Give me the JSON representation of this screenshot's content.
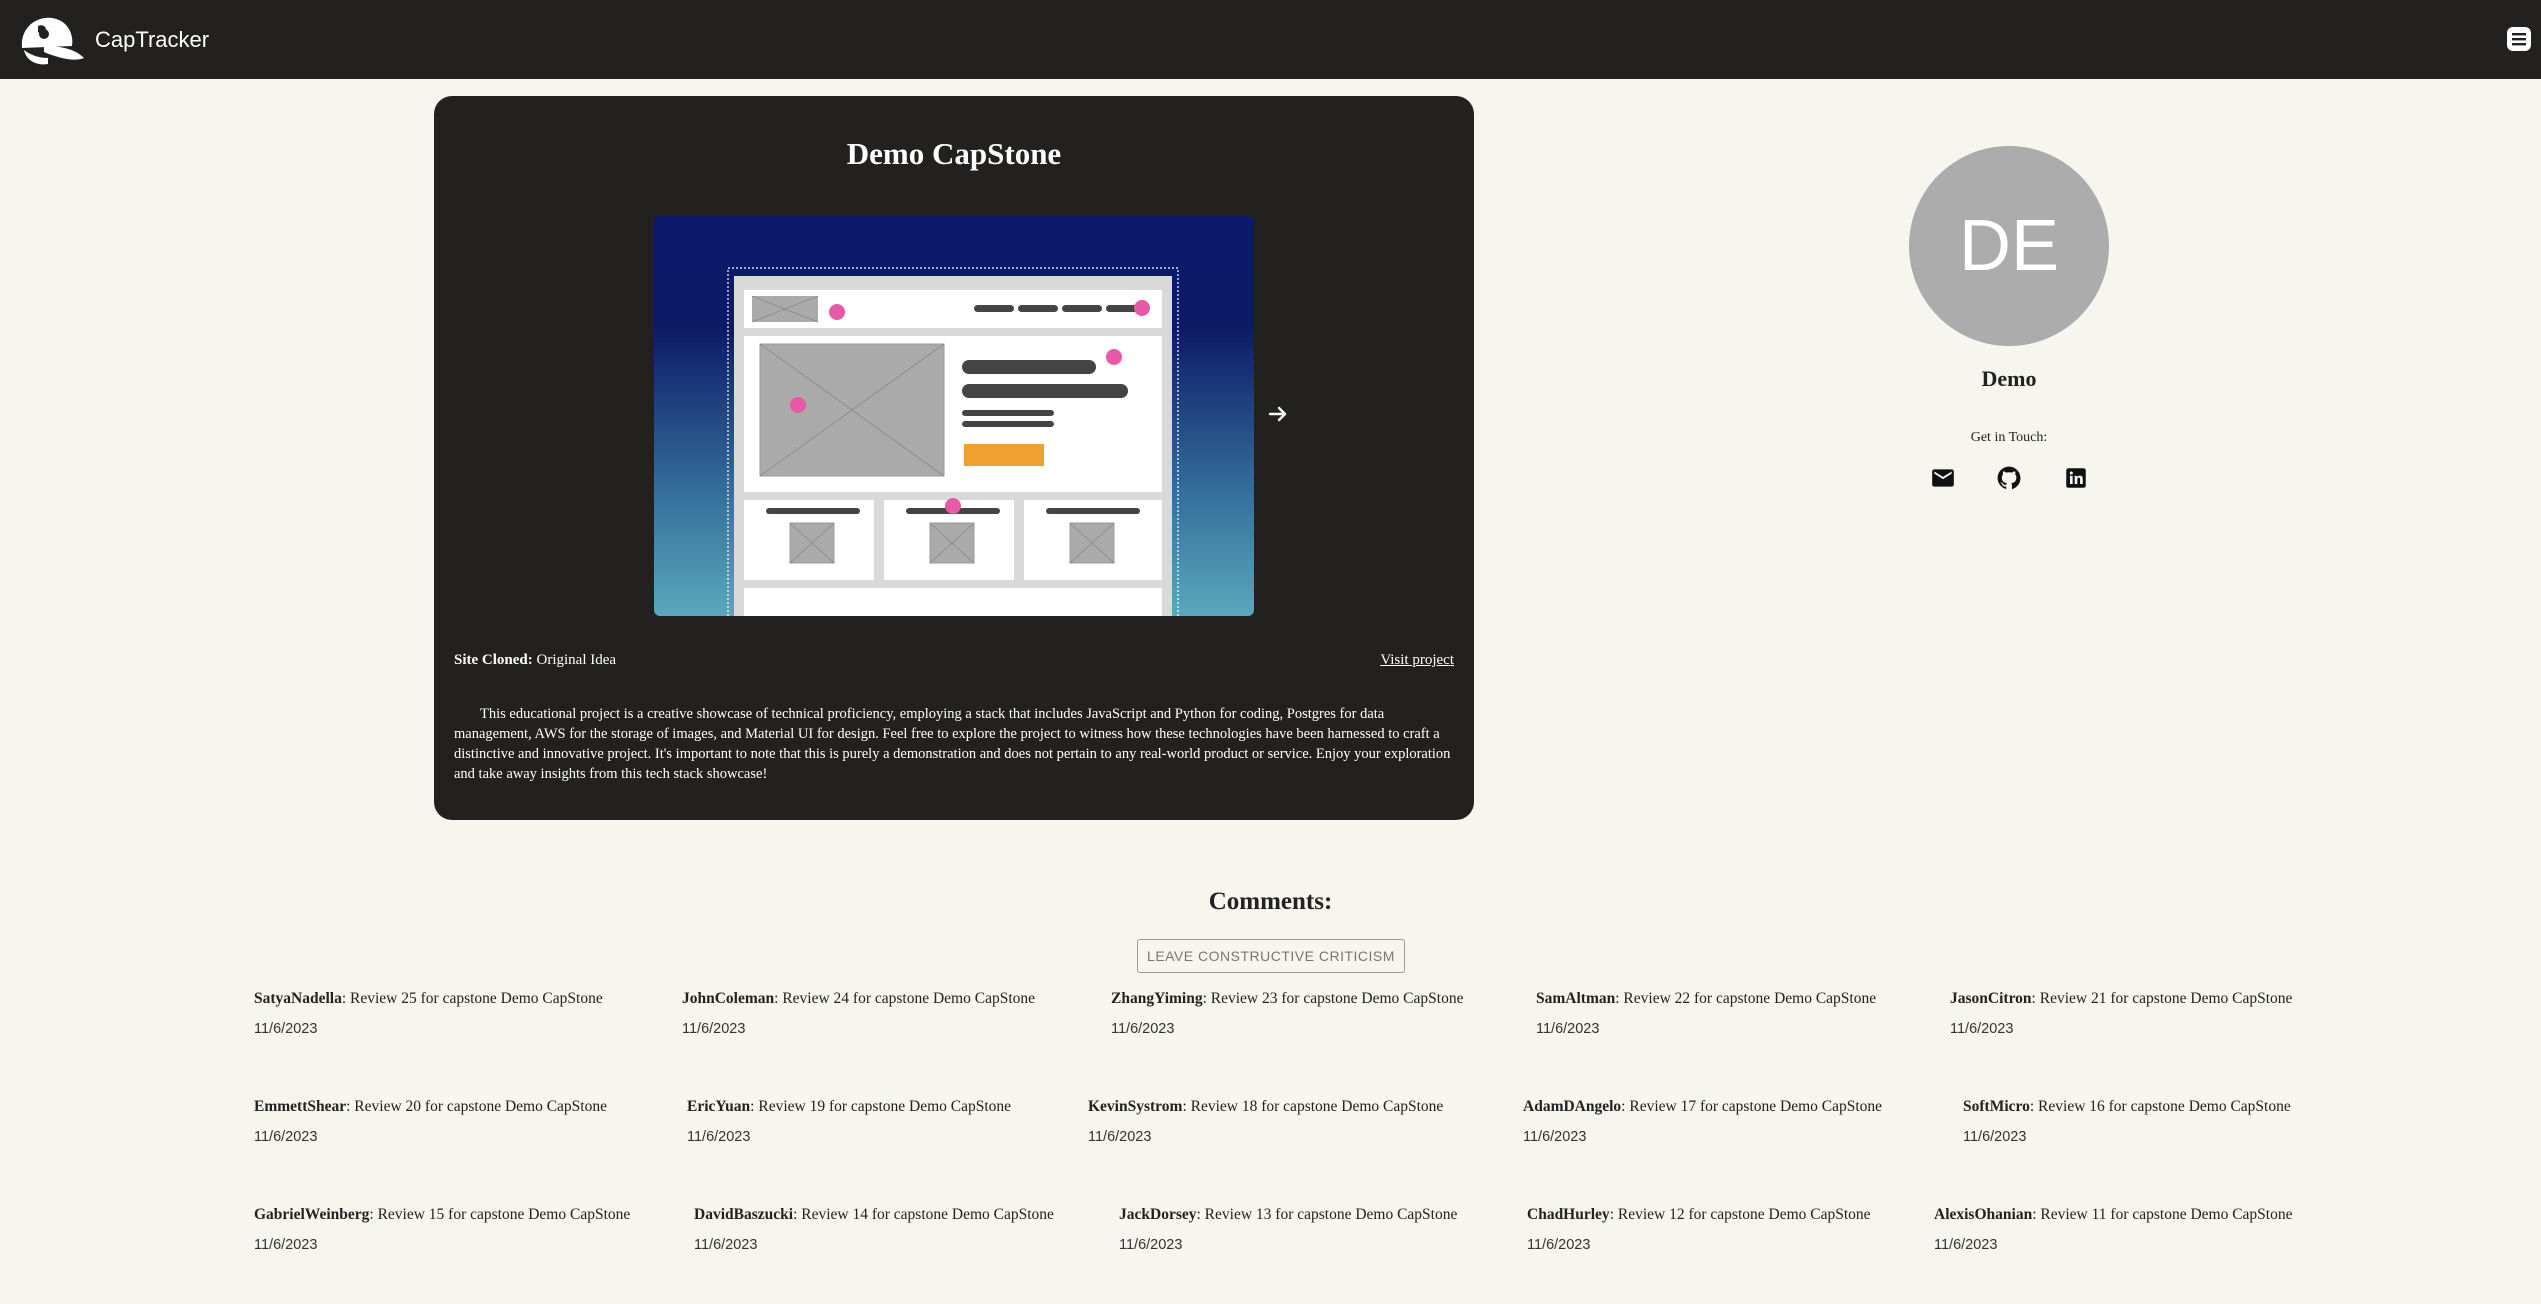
{
  "header": {
    "brand": "CapTracker",
    "logo_icon": "cap-logo-icon",
    "menu_icon": "menu-icon"
  },
  "project": {
    "title": "Demo CapStone",
    "site_cloned_label": "Site Cloned:",
    "site_cloned_value": "Original Idea",
    "visit_label": "Visit project",
    "description": "This educational project is a creative showcase of technical proficiency, employing a stack that includes JavaScript and Python for coding, Postgres for data management, AWS for the storage of images, and Material UI for design. Feel free to explore the project to witness how these technologies have been harnessed to craft a distinctive and innovative project. It's important to note that this is purely a demonstration and does not pertain to any real-world product or service. Enjoy your exploration and take away insights from this tech stack showcase!"
  },
  "profile": {
    "initials": "DE",
    "name": "Demo",
    "get_in_touch": "Get in Touch:",
    "contact_icons": [
      "email-icon",
      "github-icon",
      "linkedin-icon"
    ]
  },
  "comments": {
    "heading": "Comments:",
    "leave_button": "LEAVE CONSTRUCTIVE CRITICISM",
    "items": [
      {
        "author": "SatyaNadella",
        "text": ": Review 25 for capstone Demo CapStone",
        "date": "11/6/2023"
      },
      {
        "author": "JohnColeman",
        "text": ": Review 24 for capstone Demo CapStone",
        "date": "11/6/2023"
      },
      {
        "author": "ZhangYiming",
        "text": ": Review 23 for capstone Demo CapStone",
        "date": "11/6/2023"
      },
      {
        "author": "SamAltman",
        "text": ": Review 22 for capstone Demo CapStone",
        "date": "11/6/2023"
      },
      {
        "author": "JasonCitron",
        "text": ": Review 21 for capstone Demo CapStone",
        "date": "11/6/2023"
      },
      {
        "author": "EmmettShear",
        "text": ": Review 20 for capstone Demo CapStone",
        "date": "11/6/2023"
      },
      {
        "author": "EricYuan",
        "text": ": Review 19 for capstone Demo CapStone",
        "date": "11/6/2023"
      },
      {
        "author": "KevinSystrom",
        "text": ": Review 18 for capstone Demo CapStone",
        "date": "11/6/2023"
      },
      {
        "author": "AdamDAngelo",
        "text": ": Review 17 for capstone Demo CapStone",
        "date": "11/6/2023"
      },
      {
        "author": "SoftMicro",
        "text": ": Review 16 for capstone Demo CapStone",
        "date": "11/6/2023"
      },
      {
        "author": "GabrielWeinberg",
        "text": ": Review 15 for capstone Demo CapStone",
        "date": "11/6/2023"
      },
      {
        "author": "DavidBaszucki",
        "text": ": Review 14 for capstone Demo CapStone",
        "date": "11/6/2023"
      },
      {
        "author": "JackDorsey",
        "text": ": Review 13 for capstone Demo CapStone",
        "date": "11/6/2023"
      },
      {
        "author": "ChadHurley",
        "text": ": Review 12 for capstone Demo CapStone",
        "date": "11/6/2023"
      },
      {
        "author": "AlexisOhanian",
        "text": ": Review 11 for capstone Demo CapStone",
        "date": "11/6/2023"
      }
    ]
  },
  "colors": {
    "navbar": "#222120",
    "card": "#222120",
    "page_background": "#f6f5ee",
    "avatar": "#acacac",
    "wireframe_accent": "#e85aa7",
    "wireframe_button": "#f0a030"
  }
}
